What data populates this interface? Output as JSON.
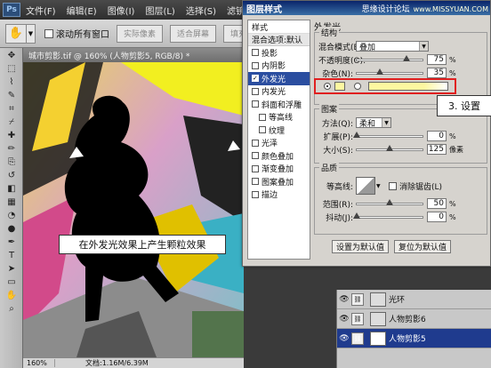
{
  "app": {
    "logo_text": "Ps",
    "menus": [
      "文件(F)",
      "编辑(E)",
      "图像(I)",
      "图层(L)",
      "选择(S)",
      "滤镜(T)",
      "分析"
    ]
  },
  "options_bar": {
    "scroll_all_label": "滚动所有窗口",
    "actual_pixels": "实际像素",
    "fit_screen": "适合屏幕",
    "fill_screen": "填充屏幕"
  },
  "toolbox": {
    "tools": [
      "move-tool",
      "marquee-tool",
      "lasso-tool",
      "quick-select-tool",
      "crop-tool",
      "slice-tool",
      "healing-brush-tool",
      "brush-tool",
      "clone-stamp-tool",
      "history-brush-tool",
      "eraser-tool",
      "gradient-tool",
      "blur-tool",
      "dodge-tool",
      "pen-tool",
      "type-tool",
      "path-select-tool",
      "shape-tool",
      "hand-tool",
      "zoom-tool"
    ],
    "glyphs": [
      "✥",
      "⬚",
      "⌇",
      "✎",
      "⌗",
      "⌿",
      "✚",
      "✏",
      "⎘",
      "↺",
      "◧",
      "▦",
      "◔",
      "●",
      "✒",
      "T",
      "➤",
      "▭",
      "✋",
      "⌕"
    ]
  },
  "document": {
    "title": "城市剪影.tif @ 160% (人物剪影5, RGB/8) *",
    "zoom": "160%",
    "info": "文档:1.16M/6.39M",
    "caption": "在外发光效果上产生颗粒效果"
  },
  "dialog": {
    "title": "图层样式",
    "watermark": "思缘设计论坛",
    "watermark_url": "www.MISSYUAN.COM",
    "styles_header": "样式",
    "blend_options": "混合选项:默认",
    "style_items": [
      {
        "label": "投影",
        "checked": false,
        "indent": false
      },
      {
        "label": "内阴影",
        "checked": false,
        "indent": false
      },
      {
        "label": "外发光",
        "checked": true,
        "indent": false,
        "active": true
      },
      {
        "label": "内发光",
        "checked": false,
        "indent": false
      },
      {
        "label": "斜面和浮雕",
        "checked": false,
        "indent": false
      },
      {
        "label": "等高线",
        "checked": false,
        "indent": true
      },
      {
        "label": "纹理",
        "checked": false,
        "indent": true
      },
      {
        "label": "光泽",
        "checked": false,
        "indent": false
      },
      {
        "label": "颜色叠加",
        "checked": false,
        "indent": false
      },
      {
        "label": "渐变叠加",
        "checked": false,
        "indent": false
      },
      {
        "label": "图案叠加",
        "checked": false,
        "indent": false
      },
      {
        "label": "描边",
        "checked": false,
        "indent": false
      }
    ],
    "section_title": "外发光",
    "structure": {
      "legend": "结构",
      "blend_mode_label": "混合模式(E):",
      "blend_mode_value": "叠加",
      "opacity_label": "不透明度(O):",
      "opacity_value": "75",
      "noise_label": "杂色(N):",
      "noise_value": "35",
      "percent": "%"
    },
    "elements": {
      "legend": "图案",
      "method_label": "方法(Q):",
      "method_value": "柔和",
      "spread_label": "扩展(P):",
      "spread_value": "0",
      "size_label": "大小(S):",
      "size_value": "125",
      "px": "像素"
    },
    "quality": {
      "legend": "品质",
      "contour_label": "等高线:",
      "antialias_label": "消除锯齿(L)",
      "range_label": "范围(R):",
      "range_value": "50",
      "jitter_label": "抖动(J):",
      "jitter_value": "0"
    },
    "make_default": "设置为默认值",
    "reset_default": "复位为默认值",
    "callout": "3. 设置"
  },
  "layers": {
    "rows": [
      {
        "name": "光环",
        "selected": false
      },
      {
        "name": "人物剪影6",
        "selected": false
      },
      {
        "name": "人物剪影5",
        "selected": true
      }
    ]
  }
}
